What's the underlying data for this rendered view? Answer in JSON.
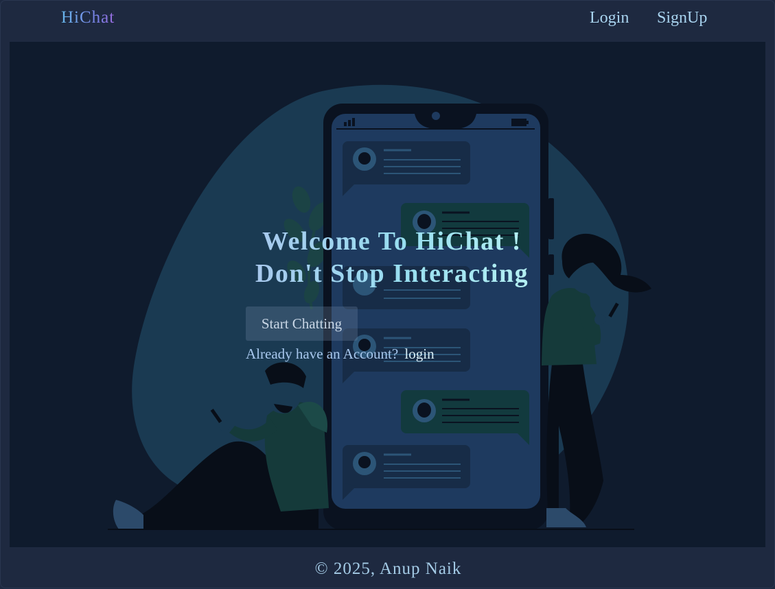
{
  "nav": {
    "brand": "HiChat",
    "login": "Login",
    "signup": "SignUp"
  },
  "hero": {
    "headline_line1": "Welcome To HiChat !",
    "headline_line2": "Don't Stop Interacting",
    "start_button": "Start Chatting",
    "account_prompt": "Already have an Account?",
    "login_link": "login"
  },
  "footer": {
    "copyright": "© 2025, Anup Naik"
  },
  "colors": {
    "page_bg": "#1e2940",
    "hero_bg": "#0f1b2d",
    "blob": "#1a3a52",
    "phone_body": "#0a1220",
    "phone_screen": "#1e3a5f",
    "bubble_left": "#172c47",
    "bubble_right": "#123a3e",
    "text_accent": "#a9d4f0"
  },
  "illustration": {
    "icons": [
      "chat-phone-illustration",
      "man-sitting-with-phone",
      "woman-standing-with-phone",
      "plant-leaves",
      "signal-icon",
      "battery-icon",
      "avatar-icon"
    ]
  }
}
